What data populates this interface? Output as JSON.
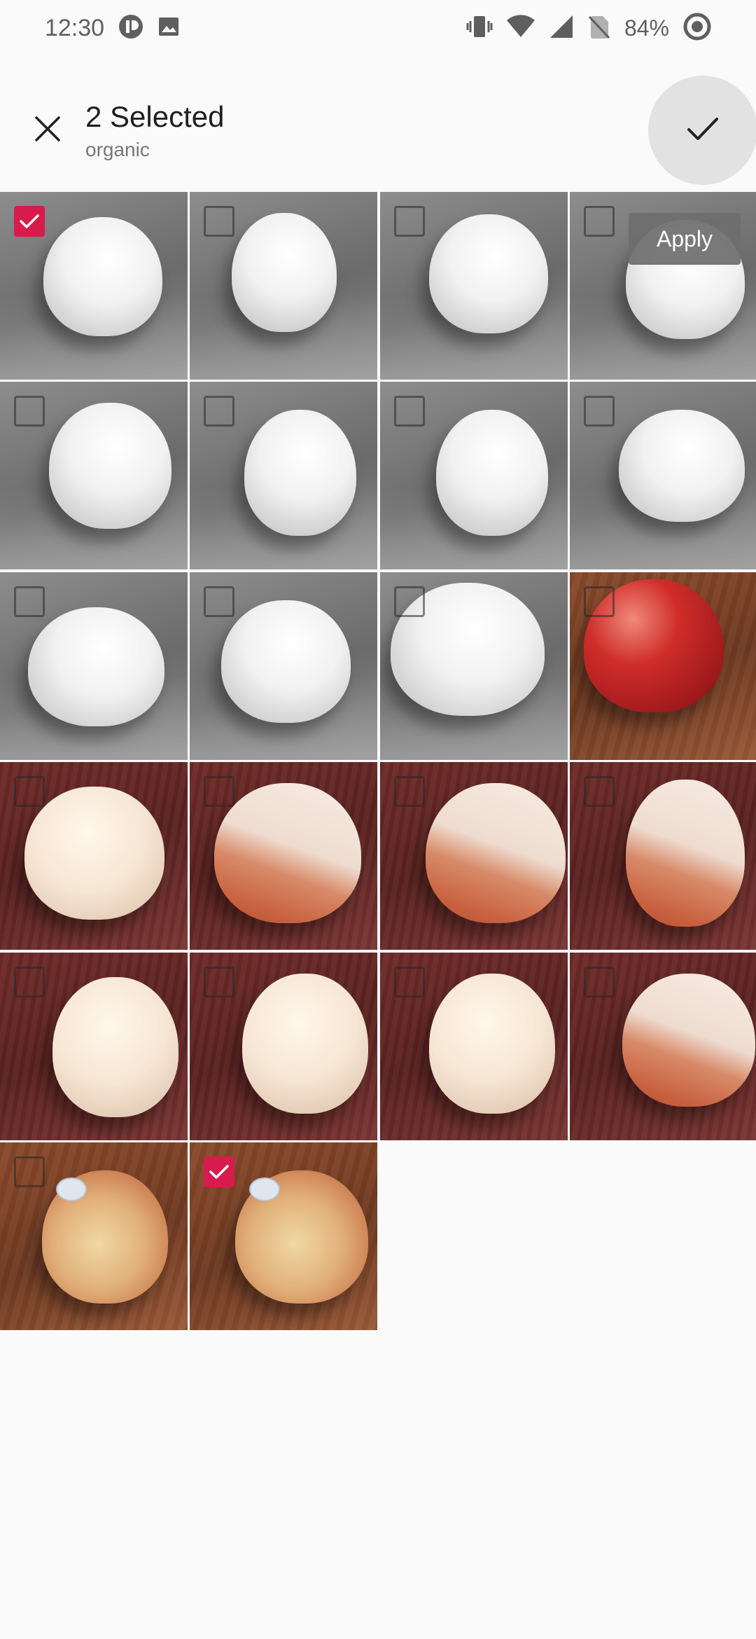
{
  "status_bar": {
    "time": "12:30",
    "battery": "84%",
    "icons": [
      "app-icon",
      "gallery-icon",
      "vibrate-icon",
      "wifi-icon",
      "signal-icon",
      "no-sim-icon",
      "battery-icon"
    ]
  },
  "app_bar": {
    "title": "2 Selected",
    "subtitle": "organic",
    "close_icon": "close-icon",
    "confirm_icon": "check-icon"
  },
  "apply_label": "Apply",
  "accent_color": "#d81b4d",
  "photos": [
    {
      "style": "gray",
      "selected": true
    },
    {
      "style": "gray",
      "selected": false
    },
    {
      "style": "gray",
      "selected": false
    },
    {
      "style": "gray",
      "selected": false
    },
    {
      "style": "gray",
      "selected": false
    },
    {
      "style": "gray",
      "selected": false
    },
    {
      "style": "gray",
      "selected": false
    },
    {
      "style": "gray",
      "selected": false
    },
    {
      "style": "gray",
      "selected": false
    },
    {
      "style": "gray",
      "selected": false
    },
    {
      "style": "gray",
      "selected": false
    },
    {
      "style": "red-apple",
      "selected": false
    },
    {
      "style": "wood-pale",
      "selected": false
    },
    {
      "style": "wood-bicolor",
      "selected": false
    },
    {
      "style": "wood-bicolor",
      "selected": false
    },
    {
      "style": "wood-bicolor",
      "selected": false
    },
    {
      "style": "wood-pale",
      "selected": false
    },
    {
      "style": "wood-pale",
      "selected": false
    },
    {
      "style": "wood-pale",
      "selected": false
    },
    {
      "style": "wood-bicolor",
      "selected": false
    },
    {
      "style": "brown-sticker",
      "selected": false
    },
    {
      "style": "brown-sticker",
      "selected": true
    }
  ]
}
